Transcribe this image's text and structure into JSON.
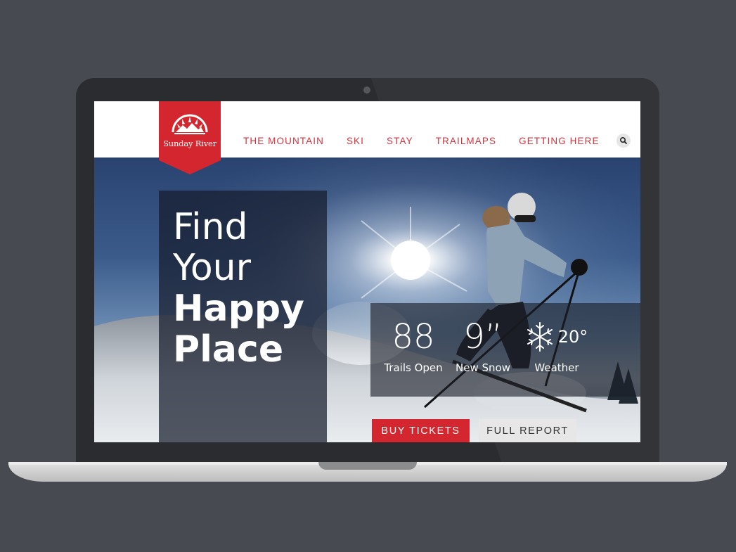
{
  "brand": {
    "name": "Sunday River",
    "accent_color": "#d4262f",
    "logo_icon": "sunrise-mountain-icon"
  },
  "nav": {
    "items": [
      {
        "label": "THE MOUNTAIN"
      },
      {
        "label": "SKI"
      },
      {
        "label": "STAY"
      },
      {
        "label": "TRAILMAPS"
      },
      {
        "label": "GETTING HERE"
      }
    ],
    "search_icon": "search-icon"
  },
  "hero": {
    "headline": {
      "line1": "Find",
      "line2": "Your",
      "line3": "Happy",
      "line4": "Place"
    },
    "image": "skier-in-sunlight"
  },
  "conditions": {
    "trails": {
      "value": "88",
      "label": "Trails Open"
    },
    "snow": {
      "value": "9”",
      "label": "New Snow"
    },
    "weather": {
      "temp": "20°",
      "label": "Weather",
      "icon": "snowflake-icon"
    }
  },
  "actions": {
    "buy_label": "BUY TICKETS",
    "report_label": "FULL REPORT"
  }
}
